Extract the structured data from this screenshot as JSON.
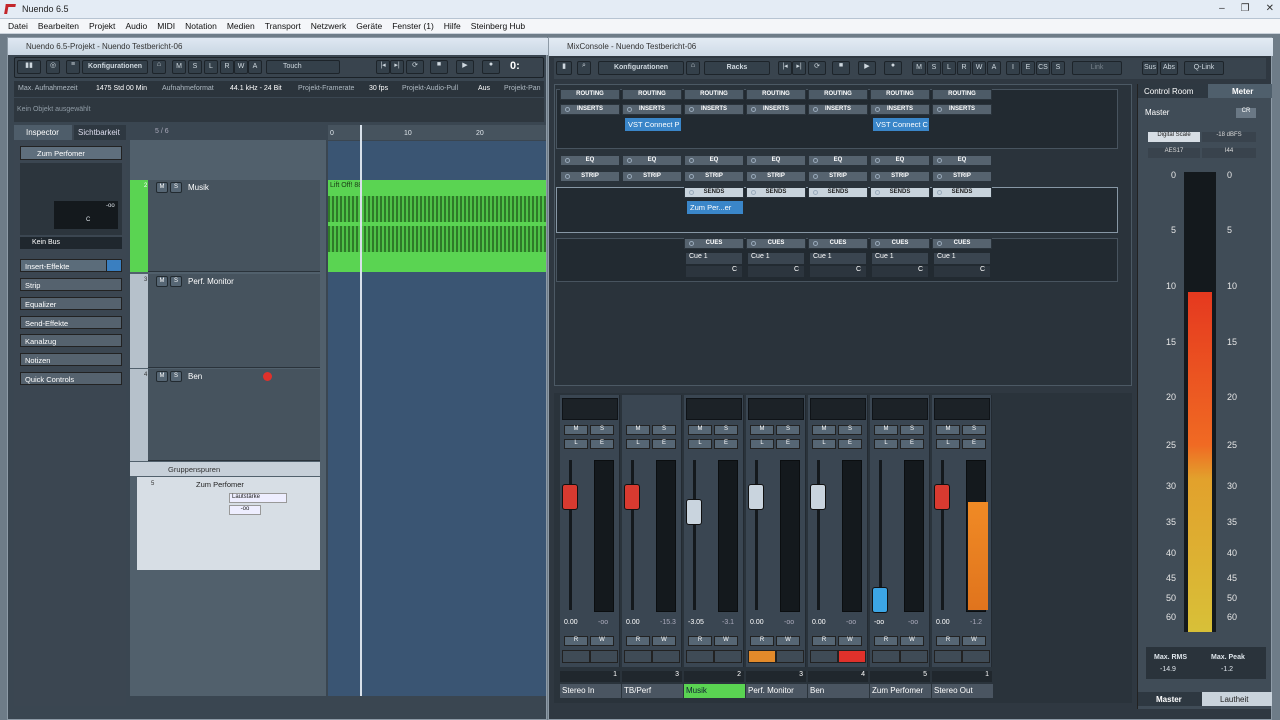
{
  "app": {
    "title": "Nuendo 6.5",
    "win_buttons": [
      "–",
      "❐",
      "✕"
    ]
  },
  "menu": [
    "Datei",
    "Bearbeiten",
    "Projekt",
    "Audio",
    "MIDI",
    "Notation",
    "Medien",
    "Transport",
    "Netzwerk",
    "Geräte",
    "Fenster (1)",
    "Hilfe",
    "Steinberg Hub"
  ],
  "project": {
    "title": "Nuendo 6.5-Projekt - Nuendo Testbericht-06",
    "toolbar": {
      "konfig": "Konfigurationen",
      "m": "M",
      "s": "S",
      "l": "L",
      "r": "R",
      "w": "W",
      "a": "A",
      "touch": "Touch",
      "time": "0:"
    },
    "info": {
      "max_time_label": "Max. Aufnahmezeit",
      "max_time": "1475 Std 00 Min",
      "format_label": "Aufnahmeformat",
      "format": "44.1 kHz - 24 Bit",
      "framerate_label": "Projekt-Framerate",
      "framerate": "30 fps",
      "pull_label": "Projekt-Audio-Pull",
      "pull": "Aus",
      "pan_label": "Projekt-Pan"
    },
    "status": "Kein Objekt ausgewählt",
    "inspector": {
      "tab1": "Inspector",
      "tab2": "Sichtbarkeit",
      "track_count": "5 / 6",
      "track": "Zum Perfomer",
      "inf": "-oo",
      "c": "C",
      "bus": "Kein Bus",
      "sections": [
        "Insert-Effekte",
        "Strip",
        "Equalizer",
        "Send-Effekte",
        "Kanalzug",
        "Notizen",
        "Quick Controls"
      ]
    },
    "ruler": [
      "0",
      "10",
      "20"
    ],
    "tracks": [
      {
        "num": "2",
        "name": "Musik",
        "clip": "Lift Off! 88"
      },
      {
        "num": "3",
        "name": "Perf. Monitor"
      },
      {
        "num": "4",
        "name": "Ben"
      }
    ],
    "group_folder": "Gruppenspuren",
    "group_track": {
      "num": "5",
      "name": "Zum Perfomer",
      "vol": "Lautstärke",
      "val": "-oo"
    }
  },
  "mixconsole": {
    "title": "MixConsole - Nuendo Testbericht-06",
    "toolbar": {
      "konfig": "Konfigurationen",
      "racks": "Racks",
      "m": "M",
      "s": "S",
      "l": "L",
      "r": "R",
      "w": "W",
      "a": "A",
      "i": "I",
      "e": "E",
      "cs": "CS",
      "s2": "S",
      "link": "Link",
      "sus": "Sus",
      "abs": "Abs",
      "qlink": "Q-Link"
    },
    "routing": "ROUTING",
    "inserts": "INSERTS",
    "eq": "EQ",
    "strip": "STRIP",
    "sends": "SENDS",
    "cues": "CUES",
    "insert_plugins": [
      "VST Connect P",
      "VST Connect C"
    ],
    "send_plugin": "Zum Per...er",
    "cue": "Cue 1",
    "c": "C",
    "channels": [
      {
        "name": "Stereo In",
        "vol": "0.00",
        "peak": "-oo",
        "num": "1"
      },
      {
        "name": "TB/Perf",
        "vol": "0.00",
        "peak": "-15.3",
        "num": "3"
      },
      {
        "name": "Musik",
        "vol": "-3.05",
        "peak": "-3.1",
        "num": "2"
      },
      {
        "name": "Perf. Monitor",
        "vol": "0.00",
        "peak": "-oo",
        "num": "3"
      },
      {
        "name": "Ben",
        "vol": "0.00",
        "peak": "-oo",
        "num": "4"
      },
      {
        "name": "Zum Perfomer",
        "vol": "-oo",
        "peak": "-oo",
        "num": "5"
      },
      {
        "name": "Stereo Out",
        "vol": "0.00",
        "peak": "-1.2",
        "num": "1"
      }
    ],
    "mslabels": [
      "M",
      "S",
      "L",
      "E",
      "R",
      "W"
    ],
    "control_room": {
      "tab1": "Control Room",
      "tab2": "Meter",
      "master": "Master",
      "cr": "CR",
      "digital_scale": "Digital Scale",
      "dbfs": "-18 dBFS",
      "aes": "AES17",
      "k": "I44",
      "scale": [
        "0",
        "5",
        "10",
        "15",
        "20",
        "25",
        "30",
        "35",
        "40",
        "45",
        "50",
        "60"
      ],
      "max_rms_label": "Max. RMS",
      "max_rms": "-14.9",
      "max_peak_label": "Max. Peak",
      "max_peak": "-1.2",
      "bottom1": "Master",
      "bottom2": "Lautheit"
    }
  },
  "colors": {
    "green_track": "#5ad452",
    "red_rec": "#e0312b",
    "orange": "#e38a2a",
    "blue_plugin": "#3a86c9"
  }
}
